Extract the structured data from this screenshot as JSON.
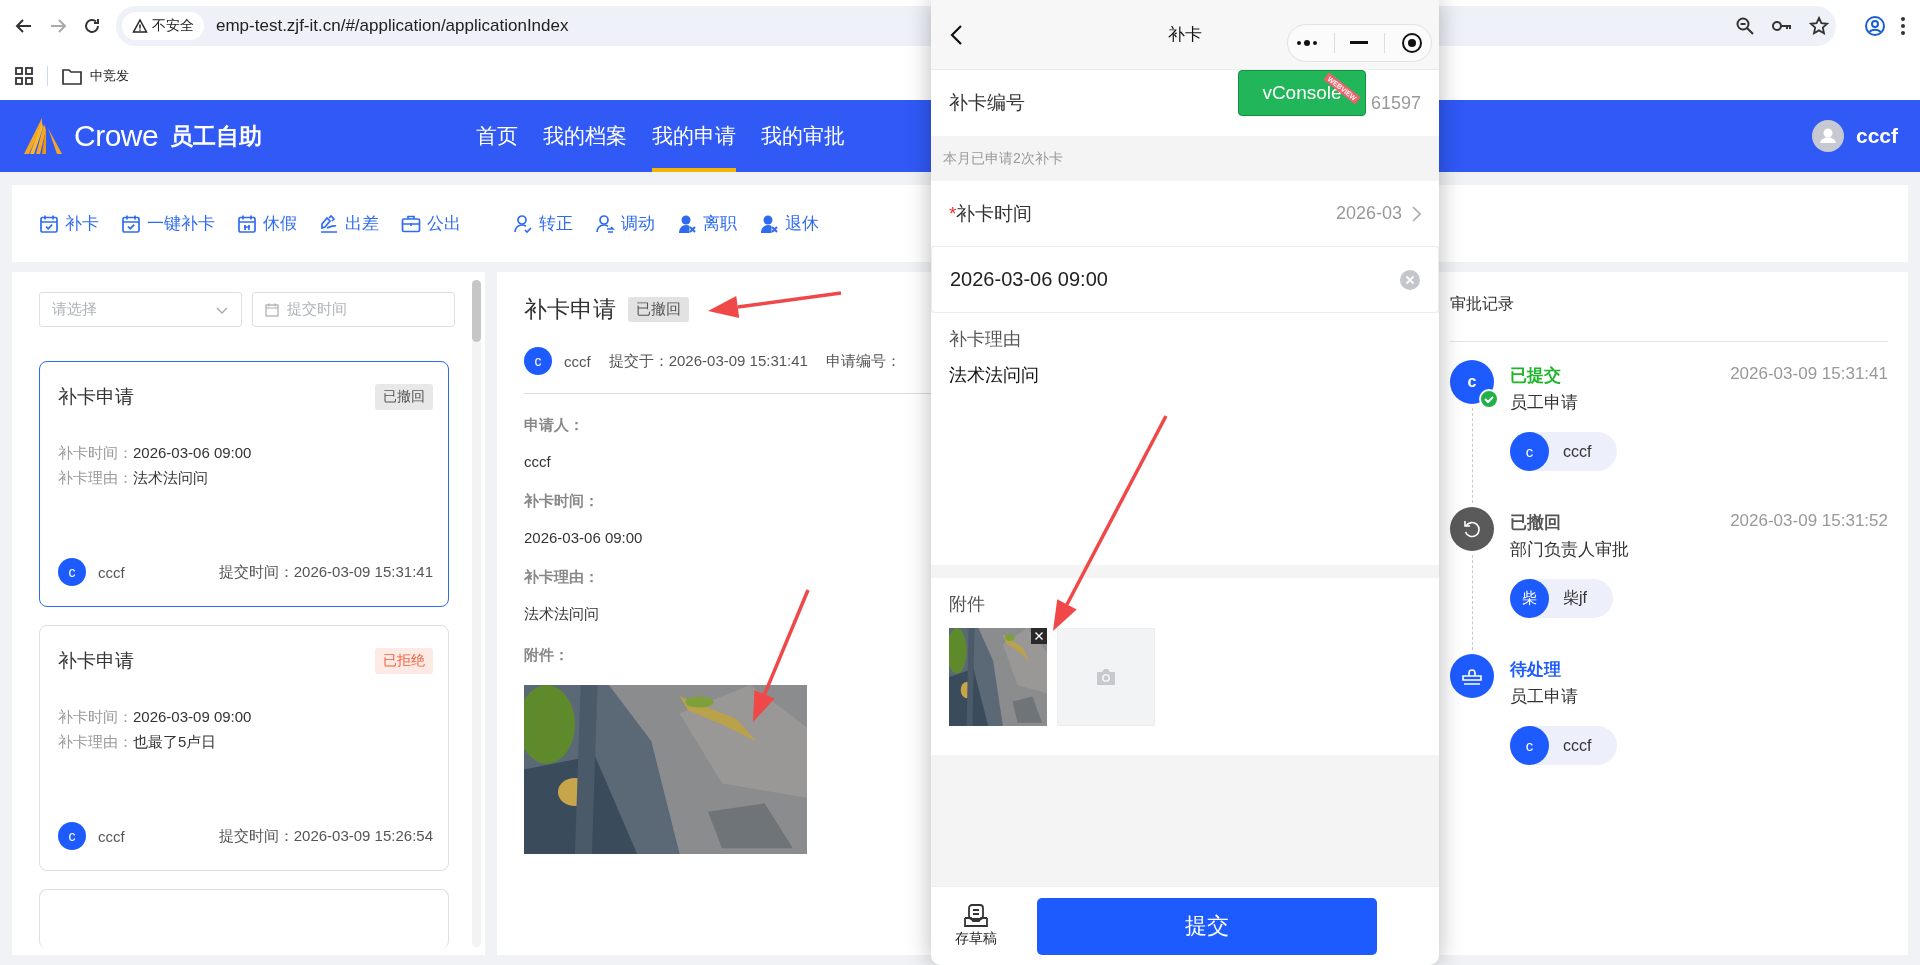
{
  "browser": {
    "security_label": "不安全",
    "url": "emp-test.zjf-it.cn/#/application/applicationIndex",
    "bookmarks": [
      {
        "label": "中竞发"
      }
    ]
  },
  "header": {
    "brand": "Crowe",
    "app_name": "员工自助",
    "user": "cccf",
    "nav": [
      {
        "label": "首页",
        "selected": false
      },
      {
        "label": "我的档案",
        "selected": false
      },
      {
        "label": "我的申请",
        "selected": true
      },
      {
        "label": "我的审批",
        "selected": false
      }
    ]
  },
  "toolbar": {
    "groups": [
      [
        {
          "label": "补卡",
          "kind": "calendar-check"
        },
        {
          "label": "一键补卡",
          "kind": "calendar-check"
        },
        {
          "label": "休假",
          "kind": "calendar-rest"
        },
        {
          "label": "出差",
          "kind": "signature"
        },
        {
          "label": "公出",
          "kind": "briefcase"
        }
      ],
      [
        {
          "label": "转正",
          "kind": "user-check"
        },
        {
          "label": "调动",
          "kind": "user-swap"
        },
        {
          "label": "离职",
          "kind": "user-x"
        },
        {
          "label": "退休",
          "kind": "user-x"
        }
      ]
    ]
  },
  "left_panel": {
    "filter": {
      "placeholder": "请选择"
    },
    "date_filter": {
      "placeholder": "提交时间"
    },
    "cards": [
      {
        "title": "补卡申请",
        "status": "已撤回",
        "color": "#555555",
        "selected": true,
        "fields": [
          {
            "label": "补卡时间：",
            "value": "2026-03-06 09:00"
          },
          {
            "label": "补卡理由：",
            "value": "法术法问问"
          }
        ],
        "avatar": "c",
        "user": "cccf",
        "submitted": "提交时间：2026-03-09 15:31:41"
      },
      {
        "title": "补卡申请",
        "status": "已拒绝",
        "color": "#f0603c",
        "selected": false,
        "fields": [
          {
            "label": "补卡时间：",
            "value": "2026-03-09 09:00"
          },
          {
            "label": "补卡理由：",
            "value": "也最了5卢日"
          }
        ],
        "avatar": "c",
        "user": "cccf",
        "submitted": "提交时间：2026-03-09 15:26:54"
      }
    ]
  },
  "detail": {
    "title": "补卡申请",
    "status": "已撤回",
    "avatar": "c",
    "user": "cccf",
    "submitted": "提交于：2026-03-09 15:31:41",
    "number_label": "申请编号：",
    "fields": [
      {
        "label": "申请人：",
        "value": "cccf"
      },
      {
        "label": "补卡时间：",
        "value": "2026-03-06 09:00"
      },
      {
        "label": "补卡理由：",
        "value": "法术法问问"
      }
    ],
    "attachment_label": "附件："
  },
  "phone": {
    "title": "补卡",
    "vconsole": "vConsole",
    "vconsole_ribbon": "WEBVIEW",
    "number_label": "补卡编号",
    "number_value": "61597",
    "notice": "本月已申请2次补卡",
    "required_mark": "*",
    "time_label": "补卡时间",
    "time_value": "2026-03",
    "datetime_value": "2026-03-06 09:00",
    "reason_label": "补卡理由",
    "reason_value": "法术法问问",
    "attachment_label": "附件",
    "draft_label": "存草稿",
    "submit_label": "提交"
  },
  "approval": {
    "title": "审批记录",
    "steps": [
      {
        "kind": "submitted",
        "avatar": "c",
        "status": "已提交",
        "color": "#1fb52a",
        "time": "2026-03-09 15:31:41",
        "step": "员工申请",
        "person": {
          "avatar": "c",
          "name": "cccf"
        }
      },
      {
        "kind": "withdrawn",
        "status": "已撤回",
        "color": "#555555",
        "time": "2026-03-09 15:31:52",
        "step": "部门负责人审批",
        "person": {
          "avatar": "柴",
          "name": "柴jf"
        }
      },
      {
        "kind": "pending",
        "status": "待处理",
        "color": "#1e5bff",
        "step": "员工申请",
        "person": {
          "avatar": "c",
          "name": "cccf"
        }
      }
    ]
  }
}
